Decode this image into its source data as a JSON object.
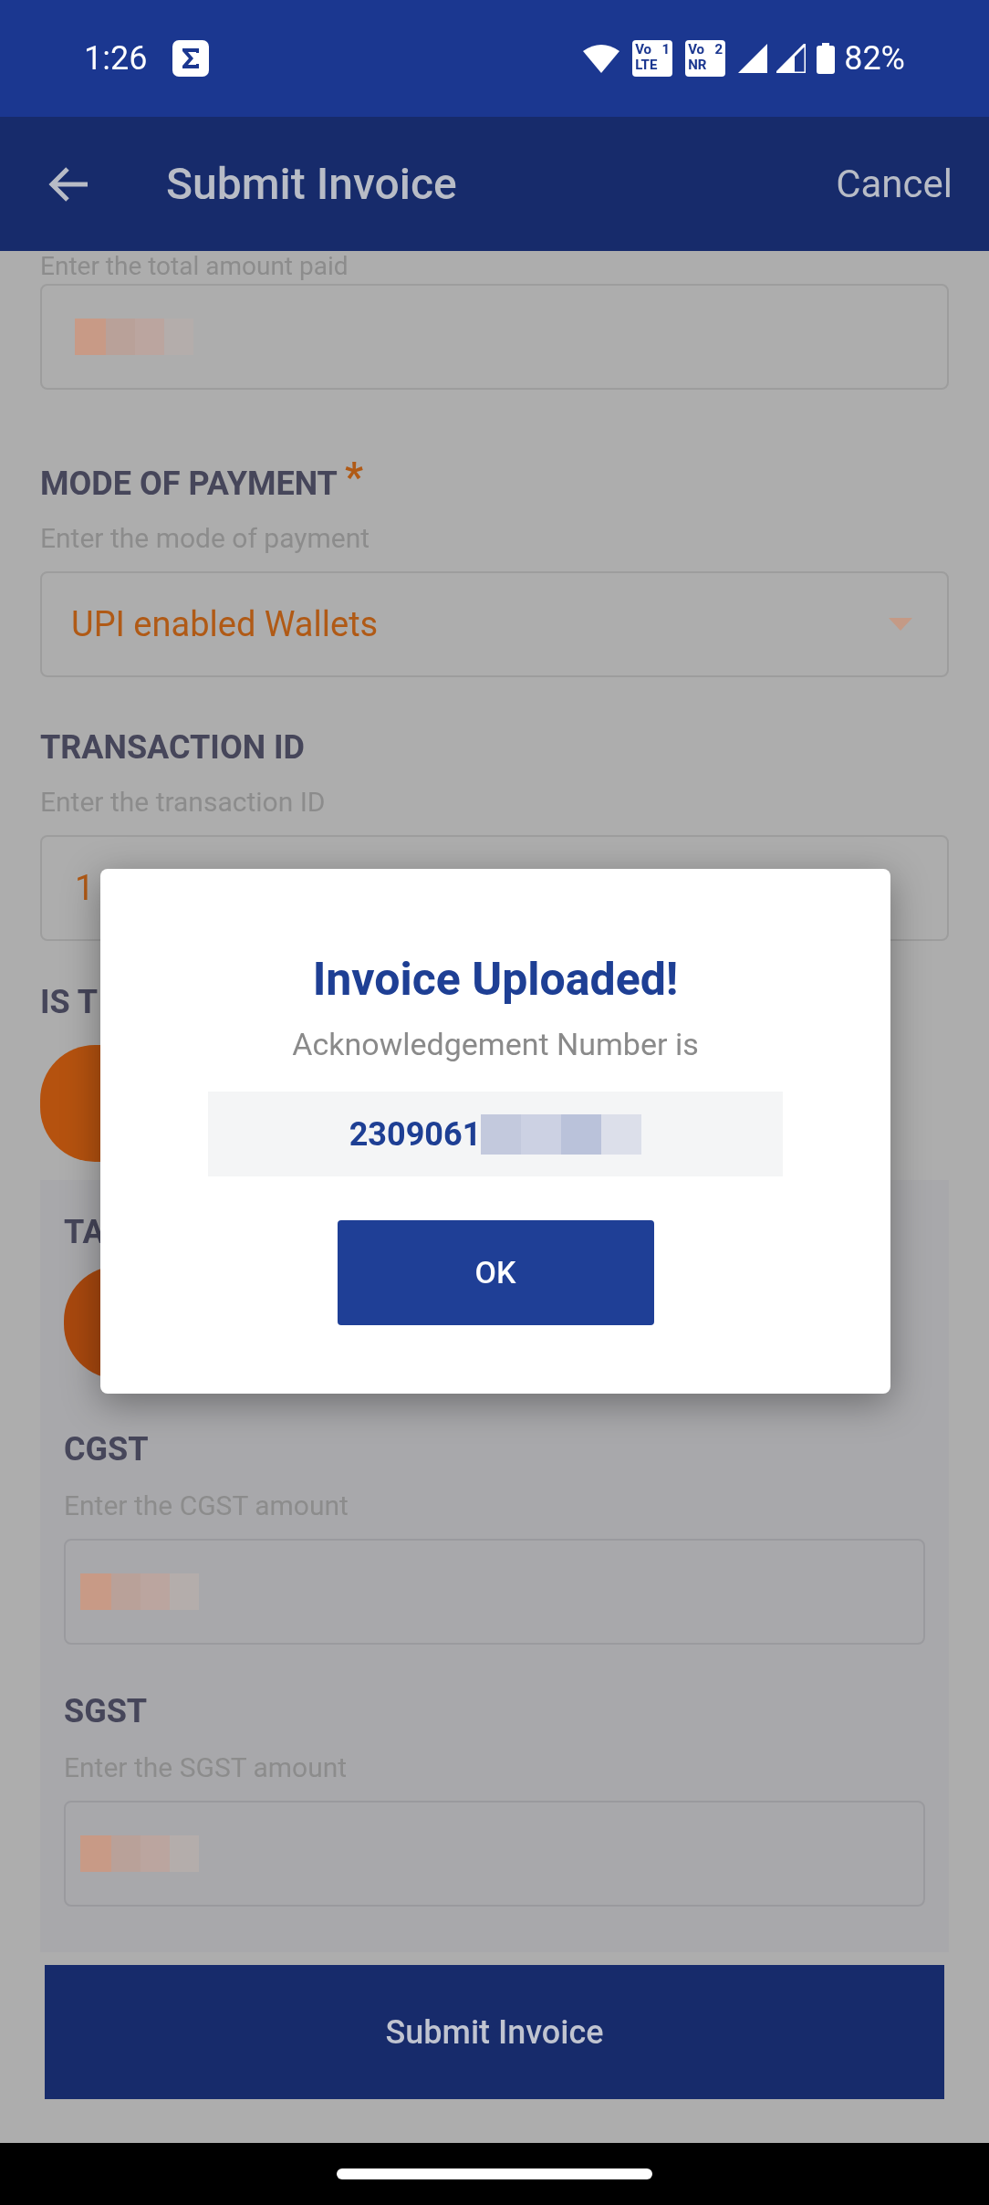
{
  "status_bar": {
    "time": "1:26",
    "battery": "82%",
    "sim_badges": [
      {
        "top": "Vo",
        "slot": "1",
        "bottom": "LTE"
      },
      {
        "top": "Vo",
        "slot": "2",
        "bottom": "NR"
      }
    ]
  },
  "header": {
    "title": "Submit Invoice",
    "action": "Cancel"
  },
  "form": {
    "total_hint": "Enter the total amount paid",
    "mode": {
      "label": "MODE OF PAYMENT",
      "required_mark": "*",
      "hint": "Enter the mode of payment",
      "value": "UPI enabled Wallets"
    },
    "transaction": {
      "label": "TRANSACTION ID",
      "hint": "Enter the transaction ID",
      "value": "1"
    },
    "question_label": "IS T",
    "panel": {
      "label": "TA",
      "fields": [
        {
          "label": "CGST",
          "hint": "Enter the CGST amount"
        },
        {
          "label": "SGST",
          "hint": "Enter the SGST amount"
        }
      ]
    }
  },
  "submit_button": "Submit Invoice",
  "dialog": {
    "title": "Invoice Uploaded!",
    "message": "Acknowledgement Number is",
    "number": "2309061",
    "button": "OK"
  }
}
